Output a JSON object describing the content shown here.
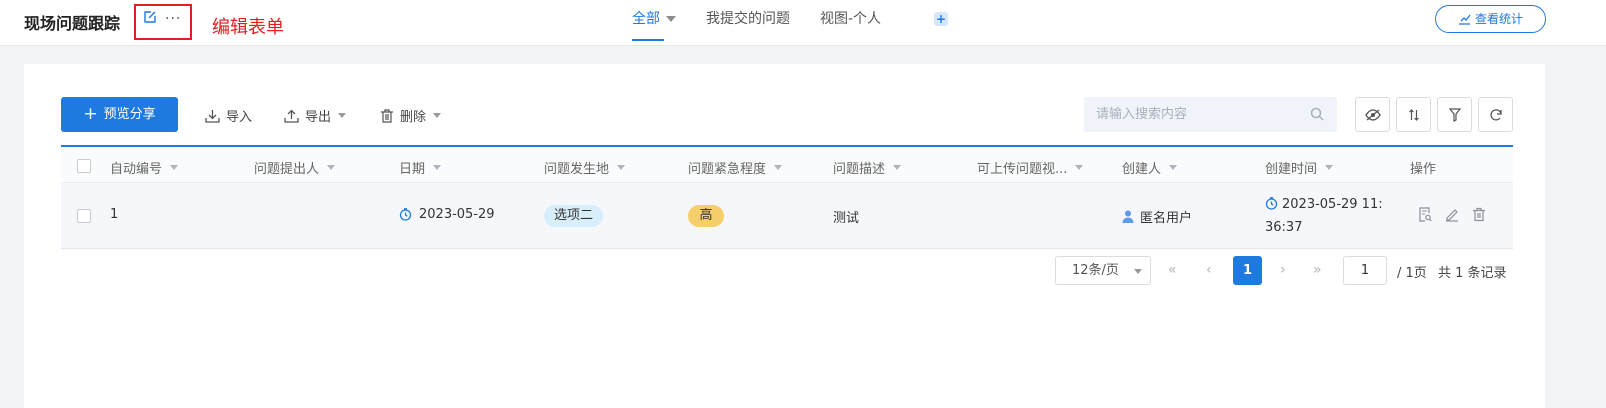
{
  "header": {
    "title": "现场问题跟踪",
    "more_label": "···",
    "annotation": "编辑表单",
    "tabs": [
      {
        "label": "全部",
        "active": true
      },
      {
        "label": "我提交的问题",
        "active": false
      },
      {
        "label": "视图-个人",
        "active": false
      }
    ],
    "add_view": "+",
    "stats_button": "查看统计"
  },
  "toolbar": {
    "primary_label": "预览分享",
    "primary_icon": "+",
    "import_label": "导入",
    "export_label": "导出",
    "delete_label": "删除",
    "search_placeholder": "请输入搜索内容"
  },
  "table": {
    "columns": [
      "自动编号",
      "问题提出人",
      "日期",
      "问题发生地",
      "问题紧急程度",
      "问题描述",
      "可上传问题视...",
      "创建人",
      "创建时间",
      "操作"
    ],
    "rows": [
      {
        "id": "1",
        "submitter": "",
        "date": "2023-05-29",
        "location": "选项二",
        "urgency": "高",
        "description": "测试",
        "video": "",
        "creator": "匿名用户",
        "created_time": "2023-05-29 11:36:37"
      }
    ]
  },
  "pagination": {
    "page_size": "12条/页",
    "first": "«",
    "prev": "‹",
    "current": "1",
    "next": "›",
    "last": "»",
    "jump_value": "1",
    "total_pages": "/ 1页",
    "total_records": "共 1 条记录"
  },
  "colors": {
    "accent": "#1f7ae0",
    "annotation": "#e02020",
    "urgency_high": "#f7cf6a",
    "option_tag": "#d8eefb"
  }
}
